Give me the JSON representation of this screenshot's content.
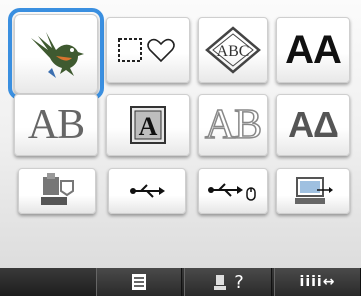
{
  "tiles": {
    "row1": [
      {
        "name": "embroidery-pattern-bird",
        "icon": "bird-icon"
      },
      {
        "name": "frame-shapes",
        "icon": "frame-heart-icon"
      },
      {
        "name": "monogram-abc",
        "icon": "abc-diamond-icon",
        "text": "ABC"
      },
      {
        "name": "font-letters",
        "text": "AA"
      }
    ],
    "row2": [
      {
        "name": "large-letters",
        "text": "AB"
      },
      {
        "name": "appliqué-letter",
        "text": "A"
      },
      {
        "name": "outline-letters",
        "text": "AB"
      },
      {
        "name": "greek-letters",
        "text": "AΔ"
      }
    ],
    "row3": [
      {
        "name": "machine-memory",
        "icon": "sewing-machine-icon"
      },
      {
        "name": "usb-media",
        "icon": "usb-icon"
      },
      {
        "name": "usb-mouse",
        "icon": "usb-mouse-icon"
      },
      {
        "name": "computer",
        "icon": "computer-usb-icon"
      }
    ]
  },
  "bottom": {
    "help_label": "?",
    "settings_label": "iiii↔"
  },
  "colors": {
    "selection": "#3a8fe0",
    "bar": "#1e1e1e"
  }
}
